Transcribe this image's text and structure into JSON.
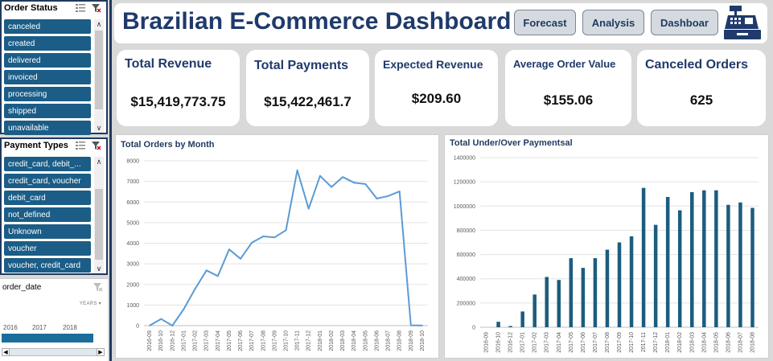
{
  "slicers": {
    "order_status": {
      "title": "Order Status",
      "items": [
        "canceled",
        "created",
        "delivered",
        "invoiced",
        "processing",
        "shipped",
        "unavailable"
      ]
    },
    "payment_types": {
      "title": "Payment Types",
      "items": [
        "credit_card, debit_...",
        "credit_card, voucher",
        "debit_card",
        "not_defined",
        "Unknown",
        "voucher",
        "voucher, credit_card"
      ]
    }
  },
  "timeline": {
    "field": "order_date",
    "level": "YEARS",
    "years": [
      "2016",
      "2017",
      "2018"
    ]
  },
  "header": {
    "title": "Brazilian E-Commerce Dashboard",
    "buttons": {
      "forecast": "Forecast",
      "analysis": "Analysis",
      "dashboard": "Dashboar"
    }
  },
  "kpis": [
    {
      "label": "Total Revenue",
      "value": "$15,419,773.75"
    },
    {
      "label": "Total Payments",
      "value": "$15,422,461.7"
    },
    {
      "label": "Expected Revenue",
      "value": "$209.60"
    },
    {
      "label": "Average Order Value",
      "value": "$155.06"
    },
    {
      "label": "Canceled Orders",
      "value": "625"
    }
  ],
  "colors": {
    "slicer_item": "#1b5d86",
    "title": "#1f3a6b",
    "line": "#5b9bd5",
    "bar": "#1b5d7e"
  },
  "chart_data": [
    {
      "type": "line",
      "title": "Total Orders by Month",
      "categories": [
        "2016-09",
        "2016-10",
        "2016-12",
        "2017-01",
        "2017-02",
        "2017-03",
        "2017-04",
        "2017-05",
        "2017-06",
        "2017-07",
        "2017-08",
        "2017-09",
        "2017-10",
        "2017-11",
        "2017-12",
        "2018-01",
        "2018-02",
        "2018-03",
        "2018-04",
        "2018-05",
        "2018-06",
        "2018-07",
        "2018-08",
        "2018-09",
        "2018-10"
      ],
      "values": [
        4,
        324,
        1,
        800,
        1780,
        2682,
        2404,
        3700,
        3245,
        4026,
        4331,
        4285,
        4631,
        7544,
        5673,
        7269,
        6728,
        7211,
        6939,
        6873,
        6167,
        6292,
        6512,
        16,
        4
      ],
      "ylim": [
        0,
        8000
      ],
      "yticks": [
        0,
        1000,
        2000,
        3000,
        4000,
        5000,
        6000,
        7000,
        8000
      ],
      "grid": true
    },
    {
      "type": "bar",
      "title": "Total Under/Over Paymentsal",
      "categories": [
        "2016-09",
        "2016-10",
        "2016-12",
        "2017-01",
        "2017-02",
        "2017-03",
        "2017-04",
        "2017-05",
        "2017-06",
        "2017-07",
        "2017-08",
        "2017-09",
        "2017-10",
        "2017-11",
        "2017-12",
        "2018-01",
        "2018-02",
        "2018-03",
        "2018-04",
        "2018-05",
        "2018-06",
        "2018-07",
        "2018-08"
      ],
      "values": [
        0,
        45000,
        10000,
        130000,
        270000,
        415000,
        390000,
        570000,
        490000,
        570000,
        640000,
        700000,
        750000,
        1150000,
        845000,
        1075000,
        965000,
        1115000,
        1130000,
        1130000,
        1010000,
        1030000,
        985000
      ],
      "ylim": [
        0,
        1400000
      ],
      "yticks": [
        0,
        200000,
        400000,
        600000,
        800000,
        1000000,
        1200000,
        1400000
      ],
      "grid": true
    }
  ]
}
